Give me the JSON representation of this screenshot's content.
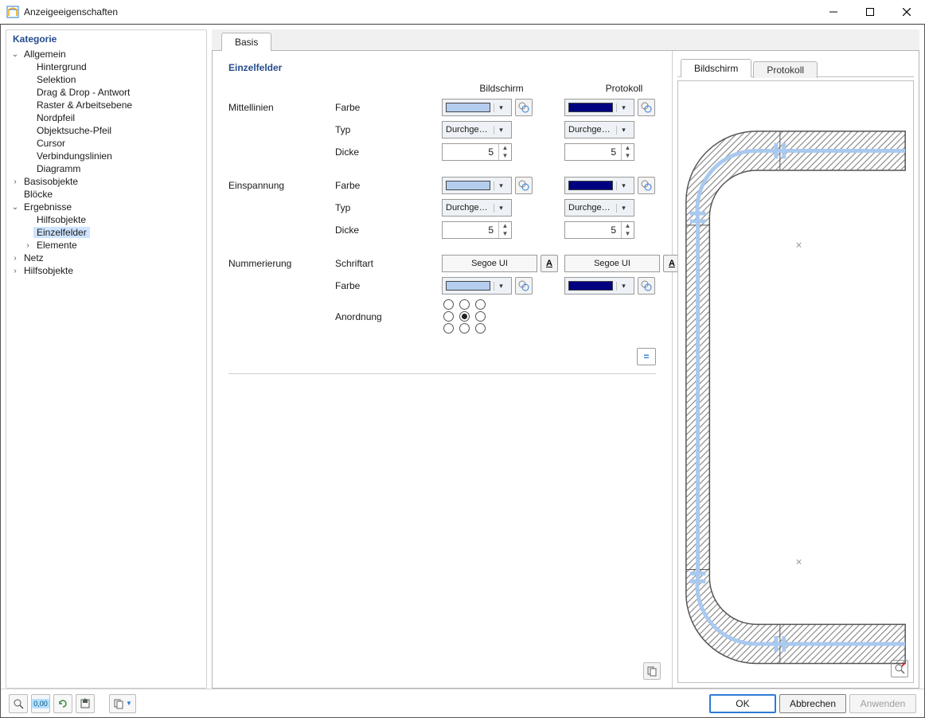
{
  "window": {
    "title": "Anzeigeeigenschaften",
    "controls": {
      "minimize": "–",
      "maximize": "▢",
      "close": "✕"
    }
  },
  "tree": {
    "heading": "Kategorie",
    "allgemein": {
      "label": "Allgemein",
      "children": {
        "hintergrund": "Hintergrund",
        "selektion": "Selektion",
        "dragdrop": "Drag & Drop - Antwort",
        "raster": "Raster & Arbeitsebene",
        "nordpfeil": "Nordpfeil",
        "objektsuche": "Objektsuche-Pfeil",
        "cursor": "Cursor",
        "verbindungslinien": "Verbindungslinien",
        "diagramm": "Diagramm"
      }
    },
    "basisobjekte": "Basisobjekte",
    "bloecke": "Blöcke",
    "ergebnisse": {
      "label": "Ergebnisse",
      "children": {
        "hilfsobjekte": "Hilfsobjekte",
        "einzelfelder": "Einzelfelder",
        "elemente": "Elemente"
      }
    },
    "netz": "Netz",
    "hilfsobjekte2": "Hilfsobjekte"
  },
  "main": {
    "tab_basis": "Basis",
    "section_title": "Einzelfelder",
    "col_screen": "Bildschirm",
    "col_proto": "Protokoll",
    "groups": {
      "mittellinien": "Mittellinien",
      "einspannung": "Einspannung",
      "nummerierung": "Nummerierung"
    },
    "fields": {
      "farbe": "Farbe",
      "typ": "Typ",
      "dicke": "Dicke",
      "schriftart": "Schriftart",
      "anordnung": "Anordnung"
    },
    "values": {
      "mittellinien": {
        "farbe_screen": "#b4cdee",
        "farbe_proto": "#000080",
        "typ_screen": "Durchgezo...",
        "typ_proto": "Durchgezo...",
        "dicke_screen": "5",
        "dicke_proto": "5"
      },
      "einspannung": {
        "farbe_screen": "#b4cdee",
        "farbe_proto": "#000080",
        "typ_screen": "Durchgezo...",
        "typ_proto": "Durchgezo...",
        "dicke_screen": "5",
        "dicke_proto": "5"
      },
      "nummerierung": {
        "font_screen": "Segoe UI",
        "font_proto": "Segoe UI",
        "farbe_screen": "#b4cdee",
        "farbe_proto": "#000080",
        "anordnung_selected_index": 4
      }
    },
    "equalize_label": "="
  },
  "preview": {
    "tab_screen": "Bildschirm",
    "tab_proto": "Protokoll"
  },
  "bottom": {
    "ok": "OK",
    "cancel": "Abbrechen",
    "apply": "Anwenden"
  },
  "colors": {
    "accent_blue": "#2e7bd6",
    "dark_blue": "#000080",
    "light_blue": "#b4cdee",
    "panel_heading": "#254b8c"
  }
}
